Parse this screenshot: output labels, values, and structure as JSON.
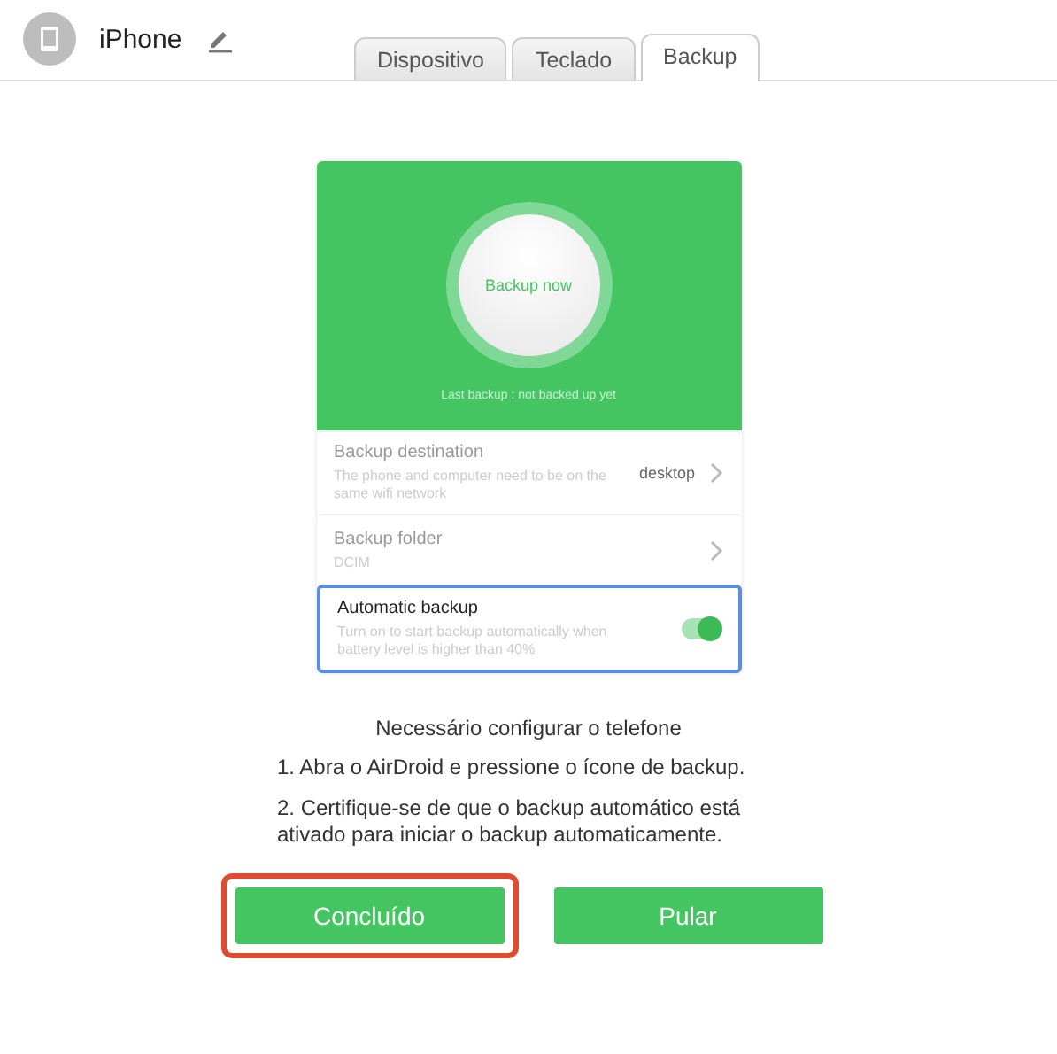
{
  "device": {
    "name": "iPhone"
  },
  "tabs": [
    {
      "label": "Dispositivo",
      "selected": false
    },
    {
      "label": "Teclado",
      "selected": false
    },
    {
      "label": "Backup",
      "selected": true
    }
  ],
  "phone": {
    "backup_button": "Backup now",
    "last_backup": "Last backup : not backed up yet",
    "settings": [
      {
        "kind": "link",
        "title": "Backup destination",
        "subtitle": "The phone and computer need to be on the same wifi network",
        "value": "desktop",
        "focused": false
      },
      {
        "kind": "link",
        "title": "Backup folder",
        "subtitle": "DCIM",
        "focused": false
      },
      {
        "kind": "toggle",
        "title": "Automatic backup",
        "subtitle": "Turn on to start backup automatically when battery level is higher than 40%",
        "on": true,
        "focused": true
      }
    ]
  },
  "instructions": {
    "title": "Necessário configurar o telefone",
    "steps": [
      "1. Abra o AirDroid e pressione o ícone de backup.",
      "2. Certifique-se de que o backup automático está ativado para iniciar o backup automaticamente."
    ]
  },
  "buttons": [
    {
      "label": "Concluído",
      "highlighted": true
    },
    {
      "label": "Pular",
      "highlighted": false
    }
  ]
}
